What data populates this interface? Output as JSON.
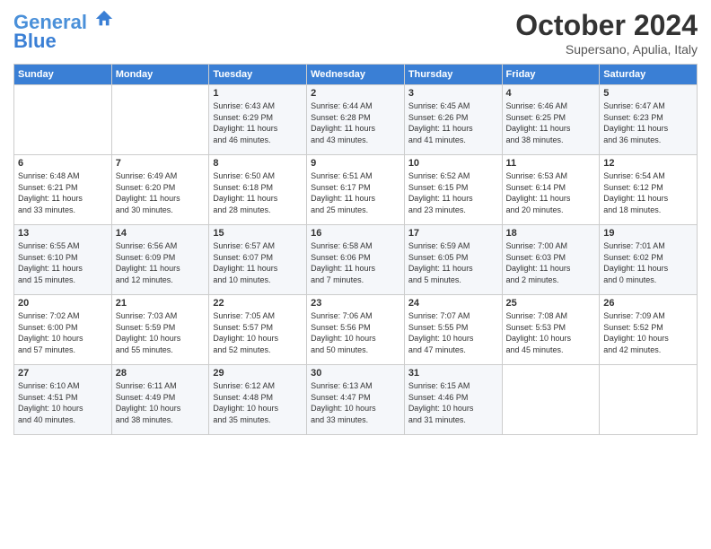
{
  "header": {
    "logo_line1": "General",
    "logo_line2": "Blue",
    "month": "October 2024",
    "location": "Supersano, Apulia, Italy"
  },
  "weekdays": [
    "Sunday",
    "Monday",
    "Tuesday",
    "Wednesday",
    "Thursday",
    "Friday",
    "Saturday"
  ],
  "weeks": [
    [
      {
        "day": "",
        "info": ""
      },
      {
        "day": "",
        "info": ""
      },
      {
        "day": "1",
        "info": "Sunrise: 6:43 AM\nSunset: 6:29 PM\nDaylight: 11 hours\nand 46 minutes."
      },
      {
        "day": "2",
        "info": "Sunrise: 6:44 AM\nSunset: 6:28 PM\nDaylight: 11 hours\nand 43 minutes."
      },
      {
        "day": "3",
        "info": "Sunrise: 6:45 AM\nSunset: 6:26 PM\nDaylight: 11 hours\nand 41 minutes."
      },
      {
        "day": "4",
        "info": "Sunrise: 6:46 AM\nSunset: 6:25 PM\nDaylight: 11 hours\nand 38 minutes."
      },
      {
        "day": "5",
        "info": "Sunrise: 6:47 AM\nSunset: 6:23 PM\nDaylight: 11 hours\nand 36 minutes."
      }
    ],
    [
      {
        "day": "6",
        "info": "Sunrise: 6:48 AM\nSunset: 6:21 PM\nDaylight: 11 hours\nand 33 minutes."
      },
      {
        "day": "7",
        "info": "Sunrise: 6:49 AM\nSunset: 6:20 PM\nDaylight: 11 hours\nand 30 minutes."
      },
      {
        "day": "8",
        "info": "Sunrise: 6:50 AM\nSunset: 6:18 PM\nDaylight: 11 hours\nand 28 minutes."
      },
      {
        "day": "9",
        "info": "Sunrise: 6:51 AM\nSunset: 6:17 PM\nDaylight: 11 hours\nand 25 minutes."
      },
      {
        "day": "10",
        "info": "Sunrise: 6:52 AM\nSunset: 6:15 PM\nDaylight: 11 hours\nand 23 minutes."
      },
      {
        "day": "11",
        "info": "Sunrise: 6:53 AM\nSunset: 6:14 PM\nDaylight: 11 hours\nand 20 minutes."
      },
      {
        "day": "12",
        "info": "Sunrise: 6:54 AM\nSunset: 6:12 PM\nDaylight: 11 hours\nand 18 minutes."
      }
    ],
    [
      {
        "day": "13",
        "info": "Sunrise: 6:55 AM\nSunset: 6:10 PM\nDaylight: 11 hours\nand 15 minutes."
      },
      {
        "day": "14",
        "info": "Sunrise: 6:56 AM\nSunset: 6:09 PM\nDaylight: 11 hours\nand 12 minutes."
      },
      {
        "day": "15",
        "info": "Sunrise: 6:57 AM\nSunset: 6:07 PM\nDaylight: 11 hours\nand 10 minutes."
      },
      {
        "day": "16",
        "info": "Sunrise: 6:58 AM\nSunset: 6:06 PM\nDaylight: 11 hours\nand 7 minutes."
      },
      {
        "day": "17",
        "info": "Sunrise: 6:59 AM\nSunset: 6:05 PM\nDaylight: 11 hours\nand 5 minutes."
      },
      {
        "day": "18",
        "info": "Sunrise: 7:00 AM\nSunset: 6:03 PM\nDaylight: 11 hours\nand 2 minutes."
      },
      {
        "day": "19",
        "info": "Sunrise: 7:01 AM\nSunset: 6:02 PM\nDaylight: 11 hours\nand 0 minutes."
      }
    ],
    [
      {
        "day": "20",
        "info": "Sunrise: 7:02 AM\nSunset: 6:00 PM\nDaylight: 10 hours\nand 57 minutes."
      },
      {
        "day": "21",
        "info": "Sunrise: 7:03 AM\nSunset: 5:59 PM\nDaylight: 10 hours\nand 55 minutes."
      },
      {
        "day": "22",
        "info": "Sunrise: 7:05 AM\nSunset: 5:57 PM\nDaylight: 10 hours\nand 52 minutes."
      },
      {
        "day": "23",
        "info": "Sunrise: 7:06 AM\nSunset: 5:56 PM\nDaylight: 10 hours\nand 50 minutes."
      },
      {
        "day": "24",
        "info": "Sunrise: 7:07 AM\nSunset: 5:55 PM\nDaylight: 10 hours\nand 47 minutes."
      },
      {
        "day": "25",
        "info": "Sunrise: 7:08 AM\nSunset: 5:53 PM\nDaylight: 10 hours\nand 45 minutes."
      },
      {
        "day": "26",
        "info": "Sunrise: 7:09 AM\nSunset: 5:52 PM\nDaylight: 10 hours\nand 42 minutes."
      }
    ],
    [
      {
        "day": "27",
        "info": "Sunrise: 6:10 AM\nSunset: 4:51 PM\nDaylight: 10 hours\nand 40 minutes."
      },
      {
        "day": "28",
        "info": "Sunrise: 6:11 AM\nSunset: 4:49 PM\nDaylight: 10 hours\nand 38 minutes."
      },
      {
        "day": "29",
        "info": "Sunrise: 6:12 AM\nSunset: 4:48 PM\nDaylight: 10 hours\nand 35 minutes."
      },
      {
        "day": "30",
        "info": "Sunrise: 6:13 AM\nSunset: 4:47 PM\nDaylight: 10 hours\nand 33 minutes."
      },
      {
        "day": "31",
        "info": "Sunrise: 6:15 AM\nSunset: 4:46 PM\nDaylight: 10 hours\nand 31 minutes."
      },
      {
        "day": "",
        "info": ""
      },
      {
        "day": "",
        "info": ""
      }
    ]
  ]
}
